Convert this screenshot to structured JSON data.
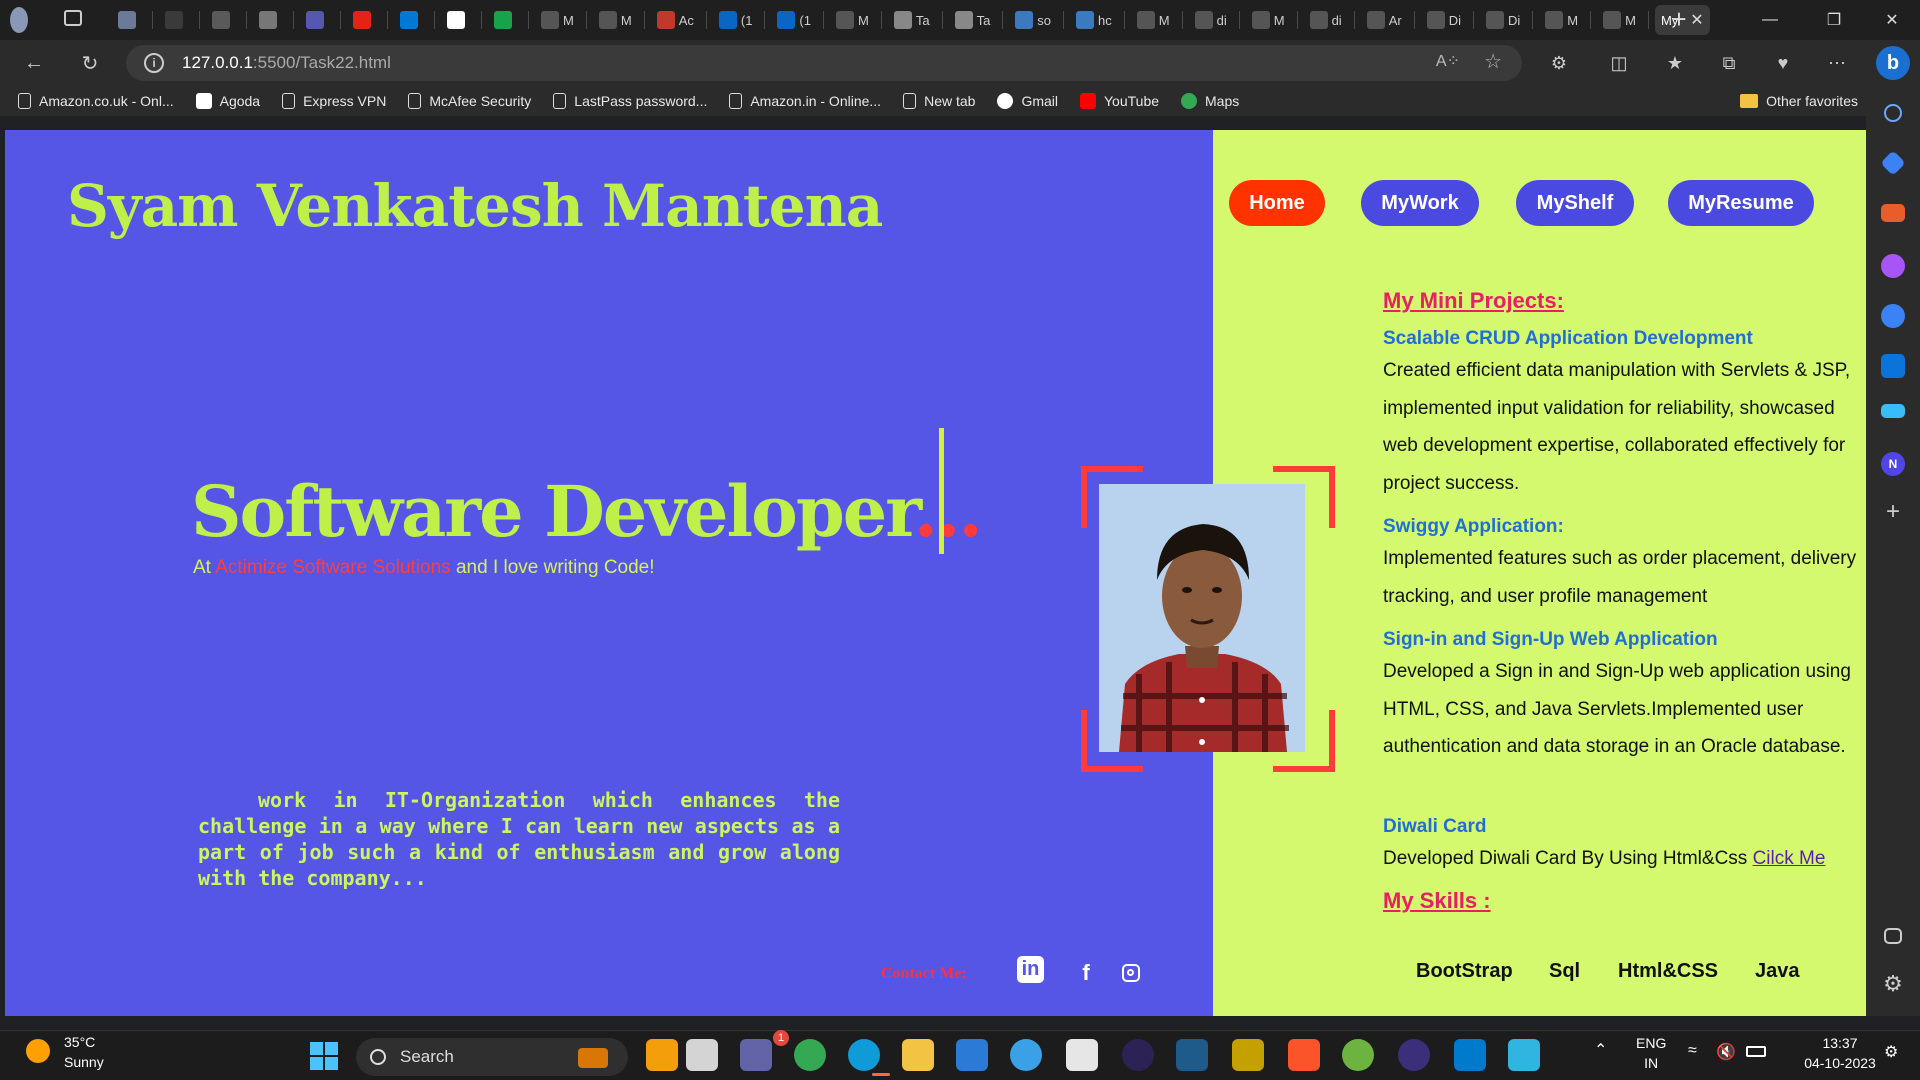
{
  "browser": {
    "tabs": [
      {
        "label": "",
        "color": "#6b7a99"
      },
      {
        "label": "",
        "color": "#3a3a3a"
      },
      {
        "label": "",
        "color": "#5a5a5a"
      },
      {
        "label": "",
        "color": "#777"
      },
      {
        "label": "",
        "color": "#5558af"
      },
      {
        "label": "",
        "color": "#e62117"
      },
      {
        "label": "",
        "color": "#0078d4"
      },
      {
        "label": "",
        "color": "#fff"
      },
      {
        "label": "",
        "color": "#16a34a"
      },
      {
        "label": "M",
        "color": "#555"
      },
      {
        "label": "M",
        "color": "#555"
      },
      {
        "label": "Ac",
        "color": "#c0392b"
      },
      {
        "label": "(1",
        "color": "#0a66c2"
      },
      {
        "label": "(1",
        "color": "#0a66c2"
      },
      {
        "label": "M",
        "color": "#555"
      },
      {
        "label": "Ta",
        "color": "#888"
      },
      {
        "label": "Ta",
        "color": "#888"
      },
      {
        "label": "so",
        "color": "#3c7ac0"
      },
      {
        "label": "hc",
        "color": "#3c7ac0"
      },
      {
        "label": "M",
        "color": "#555"
      },
      {
        "label": "di",
        "color": "#555"
      },
      {
        "label": "M",
        "color": "#555"
      },
      {
        "label": "di",
        "color": "#555"
      },
      {
        "label": "Ar",
        "color": "#555"
      },
      {
        "label": "Di",
        "color": "#555"
      },
      {
        "label": "Di",
        "color": "#555"
      },
      {
        "label": "M",
        "color": "#555"
      },
      {
        "label": "M",
        "color": "#555"
      }
    ],
    "active_tab": "My",
    "url_host": "127.0.0.1",
    "url_path": ":5500/Task22.html",
    "bookmarks": [
      {
        "label": "Amazon.co.uk - Onl...",
        "icon": "page-icon"
      },
      {
        "label": "Agoda",
        "icon": "agoda-icon"
      },
      {
        "label": "Express VPN",
        "icon": "page-icon"
      },
      {
        "label": "McAfee Security",
        "icon": "page-icon"
      },
      {
        "label": "LastPass password...",
        "icon": "page-icon"
      },
      {
        "label": "Amazon.in - Online...",
        "icon": "page-icon"
      },
      {
        "label": "New tab",
        "icon": "newtab-icon"
      },
      {
        "label": "Gmail",
        "icon": "google-icon"
      },
      {
        "label": "YouTube",
        "icon": "youtube-icon"
      },
      {
        "label": "Maps",
        "icon": "maps-icon"
      }
    ],
    "other_favorites": "Other favorites"
  },
  "header": {
    "name": "Syam Venkatesh Mantena",
    "nav": [
      "Home",
      "MyWork",
      "MyShelf",
      "MyResume"
    ]
  },
  "hero": {
    "role": "Software Developer",
    "role_dots": "...",
    "tagline_prefix": "At ",
    "company": "Actimize Software Solutions",
    "tagline_suffix": " and I love writing Code!",
    "objective": "work in IT-Organization which enhances the challenge in a way where I can learn new aspects as a part of job such a kind of enthusiasm and grow along with the company...",
    "contact_label": "Contact Me:"
  },
  "projects": {
    "title": "My Mini Projects:",
    "items": [
      {
        "title": "Scalable CRUD Application Development",
        "desc": "Created efficient data manipulation with Servlets & JSP, implemented input validation for reliability, showcased web development expertise, collaborated effectively for project success."
      },
      {
        "title": "Swiggy Application:",
        "desc": "Implemented features such as order placement, delivery tracking, and user profile management"
      },
      {
        "title": "Sign-in and Sign-Up Web Application",
        "desc": "Developed a Sign in and Sign-Up web application using HTML, CSS, and Java Servlets.Implemented user authentication and data storage in an Oracle database."
      },
      {
        "title": "Diwali Card",
        "desc": "Developed Diwali Card By Using Html&Css ",
        "link": "Cilck Me"
      }
    ]
  },
  "skills": {
    "title": "My Skills :",
    "items": [
      "BootStrap",
      "Sql",
      "Html&CSS",
      "Java"
    ]
  },
  "taskbar": {
    "temperature": "35°C",
    "condition": "Sunny",
    "search": "Search",
    "lang": "ENG",
    "region": "IN",
    "time": "13:37",
    "date": "04-10-2023",
    "badge_count": "1"
  },
  "colors": {
    "left_bg": "#5555e6",
    "right_bg": "#d4f86e",
    "accent_green": "#bff04a",
    "accent_red": "#ff3b3b",
    "home_btn": "#ff3300",
    "nav_btn": "#4a4ae0"
  }
}
